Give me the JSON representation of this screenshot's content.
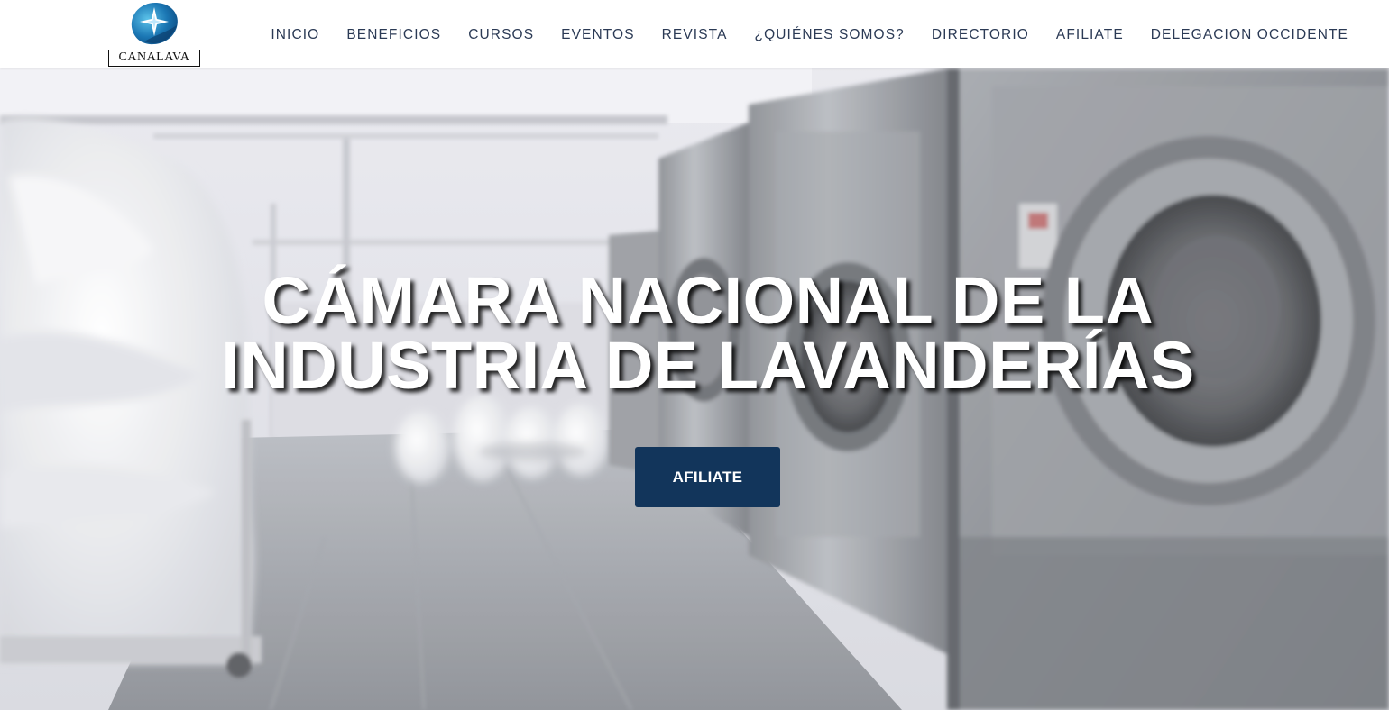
{
  "brand": {
    "wordmark": "CANALAVA",
    "logo_icon": "star-swirl-icon",
    "colors": {
      "logo_blue": "#1b6fa8",
      "logo_light": "#3aa6d8"
    }
  },
  "nav": {
    "items": [
      {
        "label": "INICIO"
      },
      {
        "label": "BENEFICIOS"
      },
      {
        "label": "CURSOS"
      },
      {
        "label": "EVENTOS"
      },
      {
        "label": "REVISTA"
      },
      {
        "label": "¿QUIÉNES SOMOS?"
      },
      {
        "label": "DIRECTORIO"
      },
      {
        "label": "AFILIATE"
      },
      {
        "label": "DELEGACION OCCIDENTE"
      }
    ],
    "color": "#2b3a55"
  },
  "hero": {
    "title_line1": "CÁMARA NACIONAL DE LA",
    "title_line2": "INDUSTRIA DE LAVANDERÍAS",
    "cta_label": "AFILIATE",
    "cta_color": "#12355b",
    "background": "laundry-room-washing-machines-photo"
  }
}
